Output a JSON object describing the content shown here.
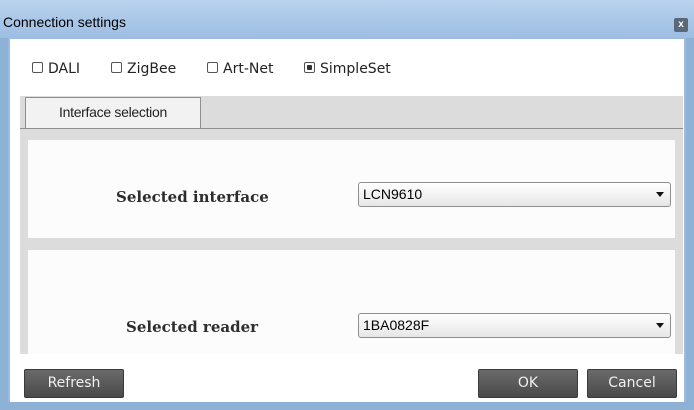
{
  "window": {
    "title": "Connection settings",
    "close_label": "x"
  },
  "protocols": [
    {
      "label": "DALI",
      "checked": false
    },
    {
      "label": "ZigBee",
      "checked": false
    },
    {
      "label": "Art-Net",
      "checked": false
    },
    {
      "label": "SimpleSet",
      "checked": true
    }
  ],
  "tabs": [
    {
      "label": "Interface selection",
      "active": true
    }
  ],
  "interface": {
    "label": "Selected interface",
    "value": "LCN9610"
  },
  "reader": {
    "label": "Selected reader",
    "value": "1BA0828F"
  },
  "buttons": {
    "refresh": "Refresh",
    "ok": "OK",
    "cancel": "Cancel"
  },
  "colors": {
    "titlebar": "#9dbde2",
    "button": "#5a5a5a",
    "panel": "#dcdcdc"
  }
}
